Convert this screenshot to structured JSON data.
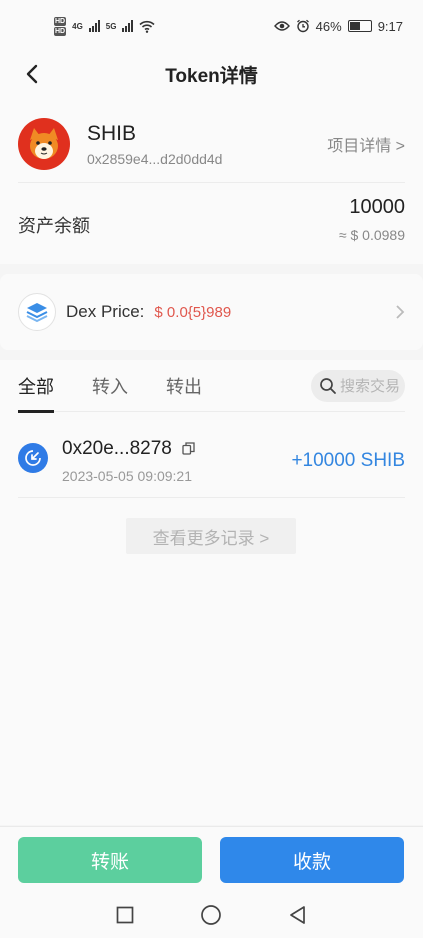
{
  "status_bar": {
    "network_left": "HD",
    "network_left2": "HD",
    "net_4g": "4G",
    "net_5g": "5G",
    "battery": "46%",
    "time": "9:17"
  },
  "nav": {
    "title": "Token详情"
  },
  "token": {
    "symbol": "SHIB",
    "address": "0x2859e4...d2d0dd4d",
    "project_link": "项目详情 >",
    "balance_label": "资产余额",
    "balance_amount": "10000",
    "balance_fiat": "≈ $ 0.0989"
  },
  "dex": {
    "label": "Dex Price:",
    "value": "$ 0.0{5}989"
  },
  "tabs": [
    {
      "label": "全部"
    },
    {
      "label": "转入"
    },
    {
      "label": "转出"
    }
  ],
  "search": {
    "placeholder": "搜索交易"
  },
  "transactions": [
    {
      "hash": "0x20e...8278",
      "time": "2023-05-05 09:09:21",
      "amount": "+10000 SHIB"
    }
  ],
  "more_records": "查看更多记录 >",
  "actions": {
    "transfer": "转账",
    "receive": "收款"
  },
  "colors": {
    "transfer_btn": "#5ccf9e",
    "receive_btn": "#2f88ea",
    "dex_price": "#e0574d",
    "amount_in": "#3386e0"
  }
}
